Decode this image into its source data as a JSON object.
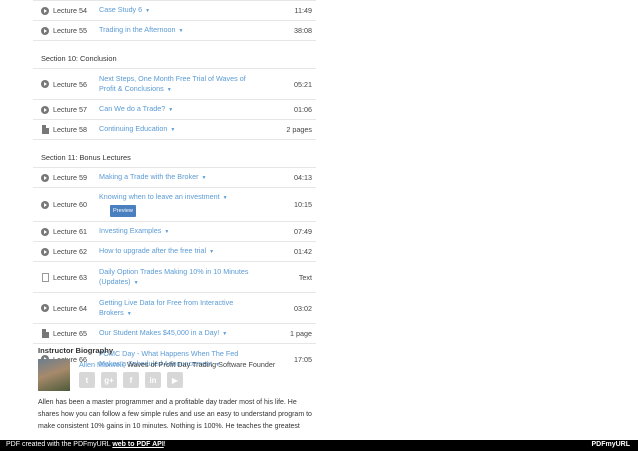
{
  "lectures_top": [
    {
      "icon": "play-icon",
      "num": "Lecture 54",
      "title": "Case Study 6",
      "duration": "11:49"
    },
    {
      "icon": "play-icon",
      "num": "Lecture 55",
      "title": "Trading in the Afternoon",
      "duration": "38:08"
    }
  ],
  "section10": {
    "heading": "Section 10: Conclusion",
    "lectures": [
      {
        "icon": "play-icon",
        "num": "Lecture 56",
        "title": "Next Steps, One Month Free Trial of Waves of Profit & Conclusions",
        "duration": "05:21"
      },
      {
        "icon": "play-icon",
        "num": "Lecture 57",
        "title": "Can We do a Trade?",
        "duration": "01:06"
      },
      {
        "icon": "document-icon",
        "num": "Lecture 58",
        "title": "Continuing Education",
        "duration": "2 pages"
      }
    ]
  },
  "section11": {
    "heading": "Section 11: Bonus Lectures",
    "lectures": [
      {
        "icon": "play-icon",
        "num": "Lecture 59",
        "title": "Making a Trade with the Broker",
        "duration": "04:13"
      },
      {
        "icon": "play-icon",
        "num": "Lecture 60",
        "title": "Knowing when to leave an investment",
        "duration": "10:15",
        "preview": "Preview"
      },
      {
        "icon": "play-icon",
        "num": "Lecture 61",
        "title": "Investing Examples",
        "duration": "07:49"
      },
      {
        "icon": "play-icon",
        "num": "Lecture 62",
        "title": "How to upgrade after the free trial",
        "duration": "01:42"
      },
      {
        "icon": "text-icon",
        "num": "Lecture 63",
        "title": "Daily Option Trades Making 10% in 10 Minutes (Updates)",
        "duration": "Text"
      },
      {
        "icon": "play-icon",
        "num": "Lecture 64",
        "title": "Getting Live Data for Free from Interactive Brokers",
        "duration": "03:02"
      },
      {
        "icon": "document-icon",
        "num": "Lecture 65",
        "title": "Our Student Makes $45,000 in a Day!",
        "duration": "1 page"
      },
      {
        "icon": "play-icon",
        "num": "Lecture 66",
        "title": "FOMC Day - What Happens When The Fed Makes a Scheduled Announcement",
        "duration": "17:05"
      }
    ]
  },
  "bio": {
    "heading": "Instructor Biography",
    "name_link": "Allen Maxwell",
    "name_rest": ", Waves of Profit Day Trading Software Founder",
    "social": [
      "twitter-icon",
      "google-plus-icon",
      "facebook-icon",
      "linkedin-icon",
      "youtube-icon"
    ],
    "text": "Allen has been a master programmer and a profitable day trader most of his life. He shares how you can follow a few simple rules and use an easy to understand program to make consistent 10% gains in 10 minutes. Nothing is 100%. He teaches the greatest"
  },
  "footer": {
    "prefix": "PDF created with the PDFmyURL ",
    "link": "web to PDF API",
    "suffix": "!",
    "logo": "PDFmyURL"
  }
}
